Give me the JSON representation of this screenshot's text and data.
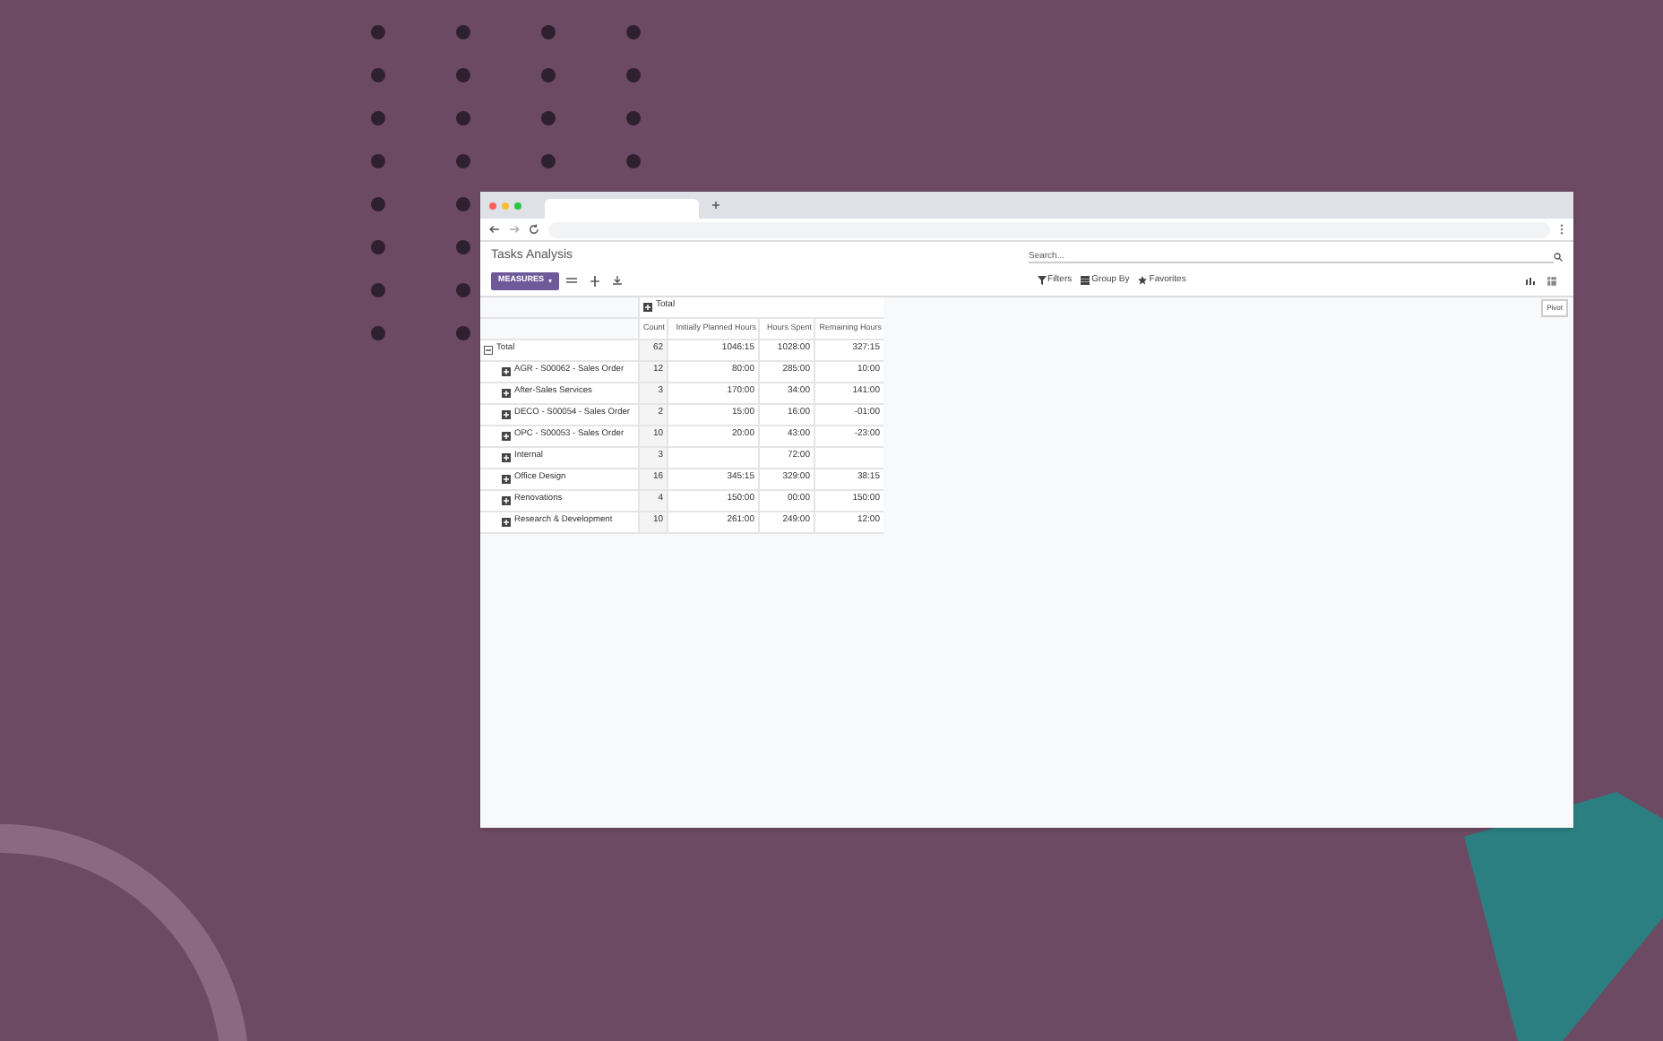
{
  "app": {
    "title": "Tasks Analysis",
    "search": {
      "placeholder": "Search..."
    },
    "measures_button": "MEASURES",
    "filters": [
      {
        "label": "Filters",
        "kind": "filter"
      },
      {
        "label": "Group By",
        "kind": "group"
      },
      {
        "label": "Favorites",
        "kind": "star"
      }
    ],
    "tooltip": "Pivot"
  },
  "pivot": {
    "column_header": "Total",
    "columns": [
      "Count",
      "Initially Planned Hours",
      "Hours Spent",
      "Remaining Hours"
    ],
    "total": {
      "label": "Total",
      "expanded": true,
      "values": {
        "count": "62",
        "initially_planned_hours": "1046:15",
        "hours_spent": "1028:00",
        "remaining_hours": "327:15"
      }
    },
    "rows": [
      {
        "label": "AGR - S00062 - Sales Order",
        "expanded": false,
        "values": {
          "count": "12",
          "initially_planned_hours": "80:00",
          "hours_spent": "285:00",
          "remaining_hours": "10:00"
        }
      },
      {
        "label": "After-Sales Services",
        "expanded": false,
        "values": {
          "count": "3",
          "initially_planned_hours": "170:00",
          "hours_spent": "34:00",
          "remaining_hours": "141:00"
        }
      },
      {
        "label": "DECO - S00054 - Sales Order",
        "expanded": false,
        "values": {
          "count": "2",
          "initially_planned_hours": "15:00",
          "hours_spent": "16:00",
          "remaining_hours": "-01:00"
        }
      },
      {
        "label": "OPC - S00053 - Sales Order",
        "expanded": false,
        "values": {
          "count": "10",
          "initially_planned_hours": "20:00",
          "hours_spent": "43:00",
          "remaining_hours": "-23:00"
        }
      },
      {
        "label": "Internal",
        "expanded": false,
        "values": {
          "count": "3",
          "hours_spent": "72:00"
        }
      },
      {
        "label": "Office Design",
        "expanded": false,
        "values": {
          "count": "16",
          "initially_planned_hours": "345:15",
          "hours_spent": "329:00",
          "remaining_hours": "38:15"
        }
      },
      {
        "label": "Renovations",
        "expanded": false,
        "values": {
          "count": "4",
          "initially_planned_hours": "150:00",
          "hours_spent": "00:00",
          "remaining_hours": "150:00"
        }
      },
      {
        "label": "Research & Development",
        "expanded": false,
        "values": {
          "count": "10",
          "initially_planned_hours": "261:00",
          "hours_spent": "249:00",
          "remaining_hours": "12:00"
        }
      }
    ]
  }
}
